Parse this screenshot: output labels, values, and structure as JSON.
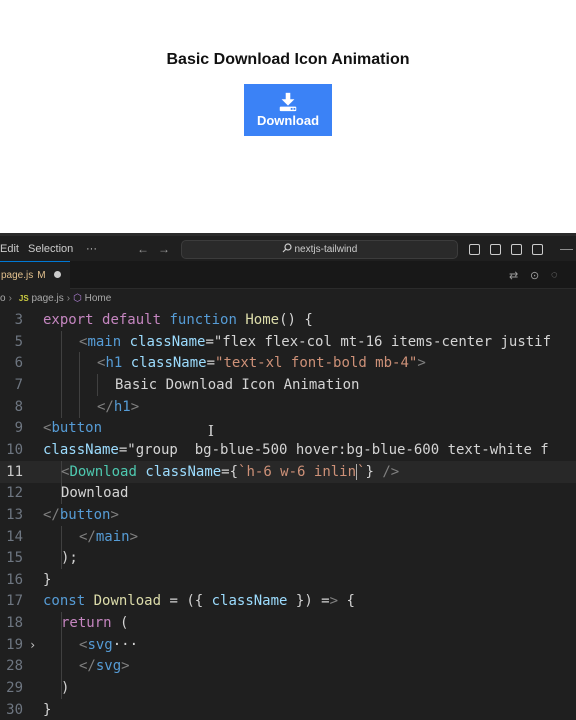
{
  "preview": {
    "title": "Basic Download Icon Animation",
    "button_label": "Download",
    "button_color": "#3b82f6"
  },
  "titlebar": {
    "menu": [
      "Edit",
      "Selection",
      "···"
    ],
    "search_text": "nextjs-tailwind"
  },
  "tab": {
    "name": "page.js",
    "modified_marker": "M"
  },
  "breadcrumb": {
    "parts": [
      "o",
      "JS",
      "page.js",
      "Home"
    ]
  },
  "code": {
    "lines": [
      {
        "n": "3",
        "t": "export default function Home() {"
      },
      {
        "n": "5",
        "t": "<main className=\"flex flex-col mt-16 items-center justif"
      },
      {
        "n": "6",
        "t": "<h1 className=\"text-xl font-bold mb-4\">"
      },
      {
        "n": "7",
        "t": "Basic Download Icon Animation"
      },
      {
        "n": "8",
        "t": "</h1>"
      },
      {
        "n": "9",
        "t": "<button"
      },
      {
        "n": "10",
        "t": "className=\"group  bg-blue-500 hover:bg-blue-600 text-white f"
      },
      {
        "n": "11",
        "t": "<Download className={`h-6 w-6 inlin`} />"
      },
      {
        "n": "12",
        "t": "Download"
      },
      {
        "n": "13",
        "t": "</button>"
      },
      {
        "n": "14",
        "t": "</main>"
      },
      {
        "n": "15",
        "t": ");"
      },
      {
        "n": "16",
        "t": "}"
      },
      {
        "n": "17",
        "t": "const Download = ({ className }) => {"
      },
      {
        "n": "18",
        "t": "return ("
      },
      {
        "n": "19",
        "t": "<svg···"
      },
      {
        "n": "28",
        "t": "</svg>"
      },
      {
        "n": "29",
        "t": ")"
      },
      {
        "n": "30",
        "t": "}"
      }
    ],
    "current_line": "11"
  },
  "icons": [
    "download-icon",
    "search-icon",
    "chevron-right-icon",
    "symbol-cube-icon"
  ]
}
